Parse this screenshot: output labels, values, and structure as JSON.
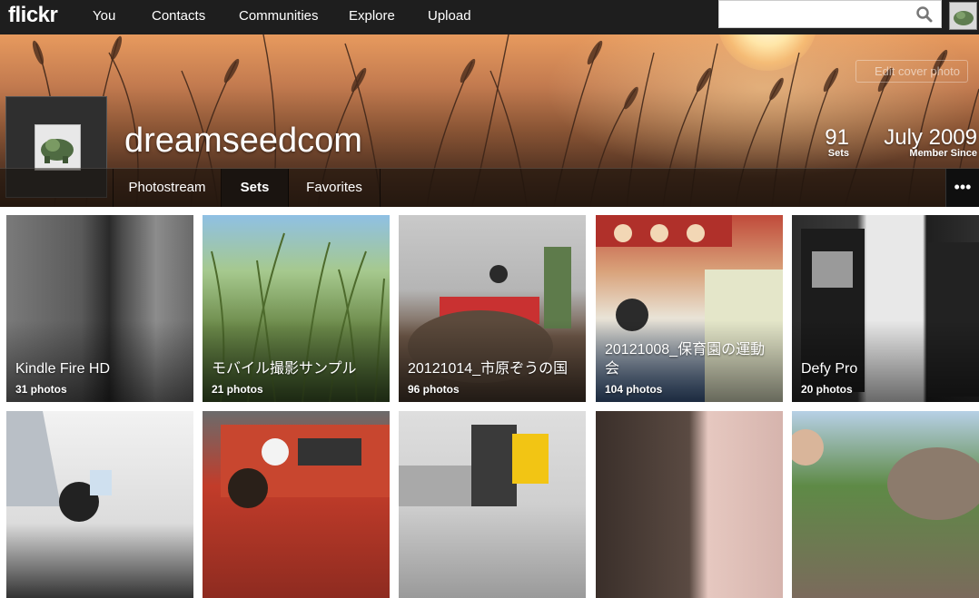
{
  "nav": {
    "logo": "flickr",
    "links": [
      "You",
      "Contacts",
      "Communities",
      "Explore",
      "Upload"
    ],
    "search_placeholder": ""
  },
  "profile": {
    "username": "dreamseedcom",
    "edit_cover_label": "Edit cover photo",
    "sets_count": "91",
    "sets_label": "Sets",
    "member_since": "July 2009",
    "member_since_label": "Member Since"
  },
  "tabs": [
    "Photostream",
    "Sets",
    "Favorites"
  ],
  "active_tab": "Sets",
  "more_label": "•••",
  "sets": [
    {
      "title": "Kindle Fire HD",
      "count": "31 photos"
    },
    {
      "title": "モバイル撮影サンプル",
      "count": "21 photos"
    },
    {
      "title": "20121014_市原ぞうの国",
      "count": "96 photos"
    },
    {
      "title": "20121008_保育園の運動会",
      "count": "104 photos"
    },
    {
      "title": "Defy Pro",
      "count": "20 photos"
    }
  ],
  "colors": {
    "nav_bg": "#1e1e1e",
    "cover_accent": "#e79a5e"
  }
}
